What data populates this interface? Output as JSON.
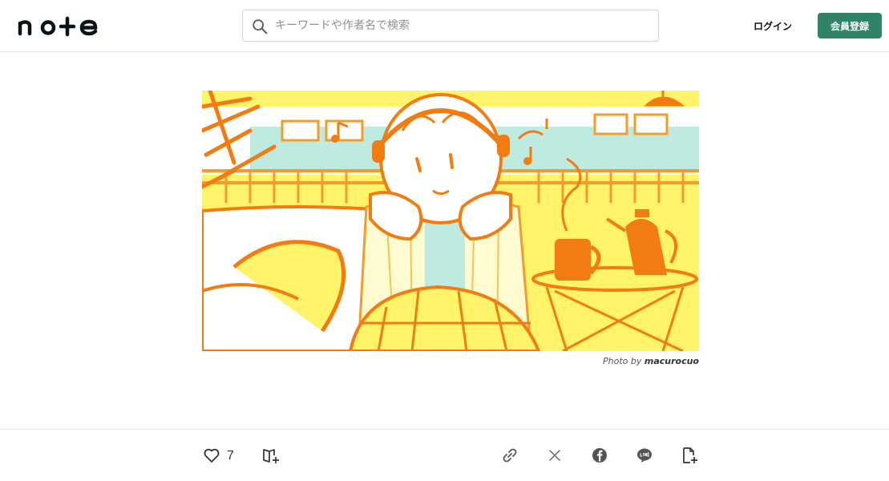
{
  "header": {
    "logo_text": "note",
    "search": {
      "placeholder": "キーワードや作者名で検索",
      "value": ""
    },
    "login_label": "ログイン",
    "signup_label": "会員登録",
    "accent_color": "#2f8466"
  },
  "hero": {
    "image_description": "illustration: girl with headphones resting her chin on her hands beside a coffee mug and pot",
    "credit_prefix": "Photo by",
    "credit_author": "macurocuo"
  },
  "actions": {
    "like_count": "7",
    "icons": [
      "heart-icon",
      "magazine-add-icon",
      "link-icon",
      "x-icon",
      "facebook-icon",
      "line-icon",
      "note-add-icon"
    ]
  }
}
